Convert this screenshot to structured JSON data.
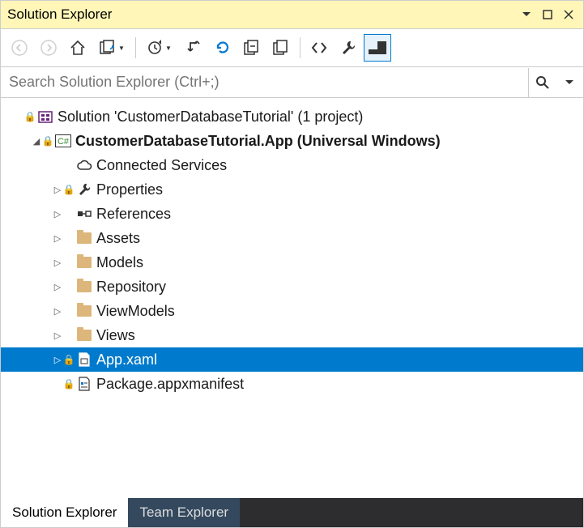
{
  "title": "Solution Explorer",
  "search_placeholder": "Search Solution Explorer (Ctrl+;)",
  "tree": {
    "solution": "Solution 'CustomerDatabaseTutorial' (1 project)",
    "project": "CustomerDatabaseTutorial.App (Universal Windows)",
    "connected": "Connected Services",
    "properties": "Properties",
    "references": "References",
    "assets": "Assets",
    "models": "Models",
    "repository": "Repository",
    "viewmodels": "ViewModels",
    "views": "Views",
    "appxaml": "App.xaml",
    "manifest": "Package.appxmanifest"
  },
  "tabs": {
    "solution": "Solution Explorer",
    "team": "Team Explorer"
  }
}
